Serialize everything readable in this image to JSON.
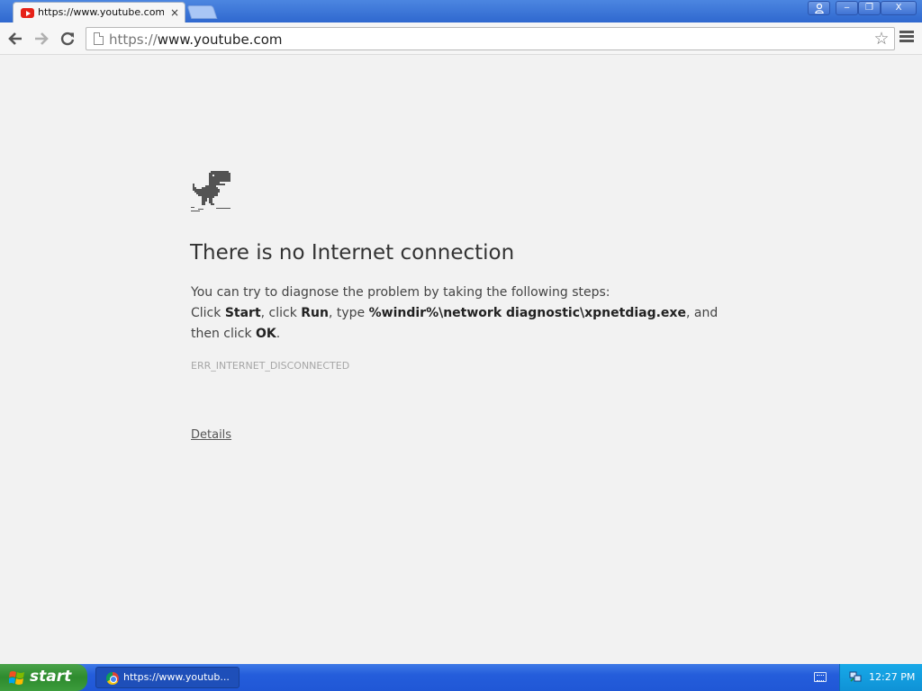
{
  "browser": {
    "tab": {
      "title": "https://www.youtube.com/ i",
      "favicon": "youtube-favicon",
      "close_glyph": "×"
    },
    "window_controls": {
      "user_glyph": "👤",
      "minimize_glyph": "‒",
      "maximize_glyph": "❐",
      "close_glyph": "X"
    },
    "toolbar": {
      "back_glyph": "🡐",
      "forward_glyph": "🡒",
      "reload_glyph": "⟳",
      "star_glyph": "☆"
    },
    "omnibox": {
      "scheme": "https://",
      "host": "www.youtube.com"
    }
  },
  "error_page": {
    "title": "There is no Internet connection",
    "line1": "You can try to diagnose the problem by taking the following steps:",
    "line2_prefix": "Click ",
    "start_word": "Start",
    "line2_mid1": ", click ",
    "run_word": "Run",
    "line2_mid2": ", type ",
    "command": "%windir%\\network diagnostic\\xpnetdiag.exe",
    "line2_suffix": ", and",
    "line3_prefix": "then click ",
    "ok_word": "OK",
    "line3_suffix": ".",
    "error_code": "ERR_INTERNET_DISCONNECTED",
    "details_link": "Details"
  },
  "taskbar": {
    "start_label": "start",
    "task_item_label": "https://www.youtub...",
    "clock": "12:27 PM"
  },
  "colors": {
    "titlebar_blue": "#2f68cf",
    "taskbar_blue": "#245ddb",
    "start_green": "#2e8b2e",
    "page_background": "#f2f2f2",
    "youtube_red": "#e62117"
  }
}
